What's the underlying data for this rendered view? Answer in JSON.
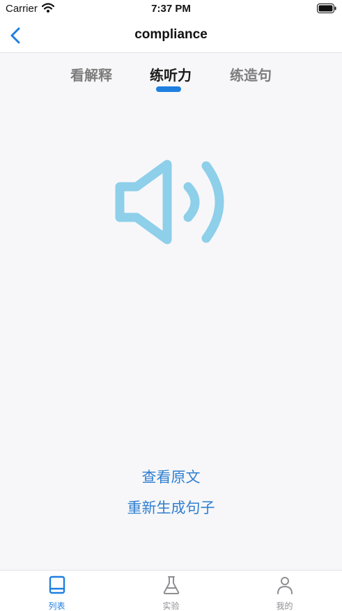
{
  "status_bar": {
    "carrier": "Carrier",
    "time": "7:37 PM",
    "icons": [
      "wifi-icon",
      "battery-icon"
    ]
  },
  "nav": {
    "title": "compliance",
    "back_icon": "chevron-left-icon"
  },
  "tabs": {
    "items": [
      {
        "label": "看解释"
      },
      {
        "label": "练听力"
      },
      {
        "label": "练造句"
      }
    ],
    "active_index": 1
  },
  "player": {
    "icon": "speaker-volume-icon",
    "color": "#8ecfea"
  },
  "actions": {
    "view_original": "查看原文",
    "regenerate": "重新生成句子"
  },
  "tab_bar": {
    "items": [
      {
        "label": "列表",
        "icon": "book-icon"
      },
      {
        "label": "实验",
        "icon": "flask-icon"
      },
      {
        "label": "我的",
        "icon": "person-icon"
      }
    ],
    "active_index": 0
  },
  "colors": {
    "accent": "#1e7fe0",
    "link": "#2f7fd0",
    "inactive": "#8e8e93",
    "background": "#f7f7f9"
  }
}
